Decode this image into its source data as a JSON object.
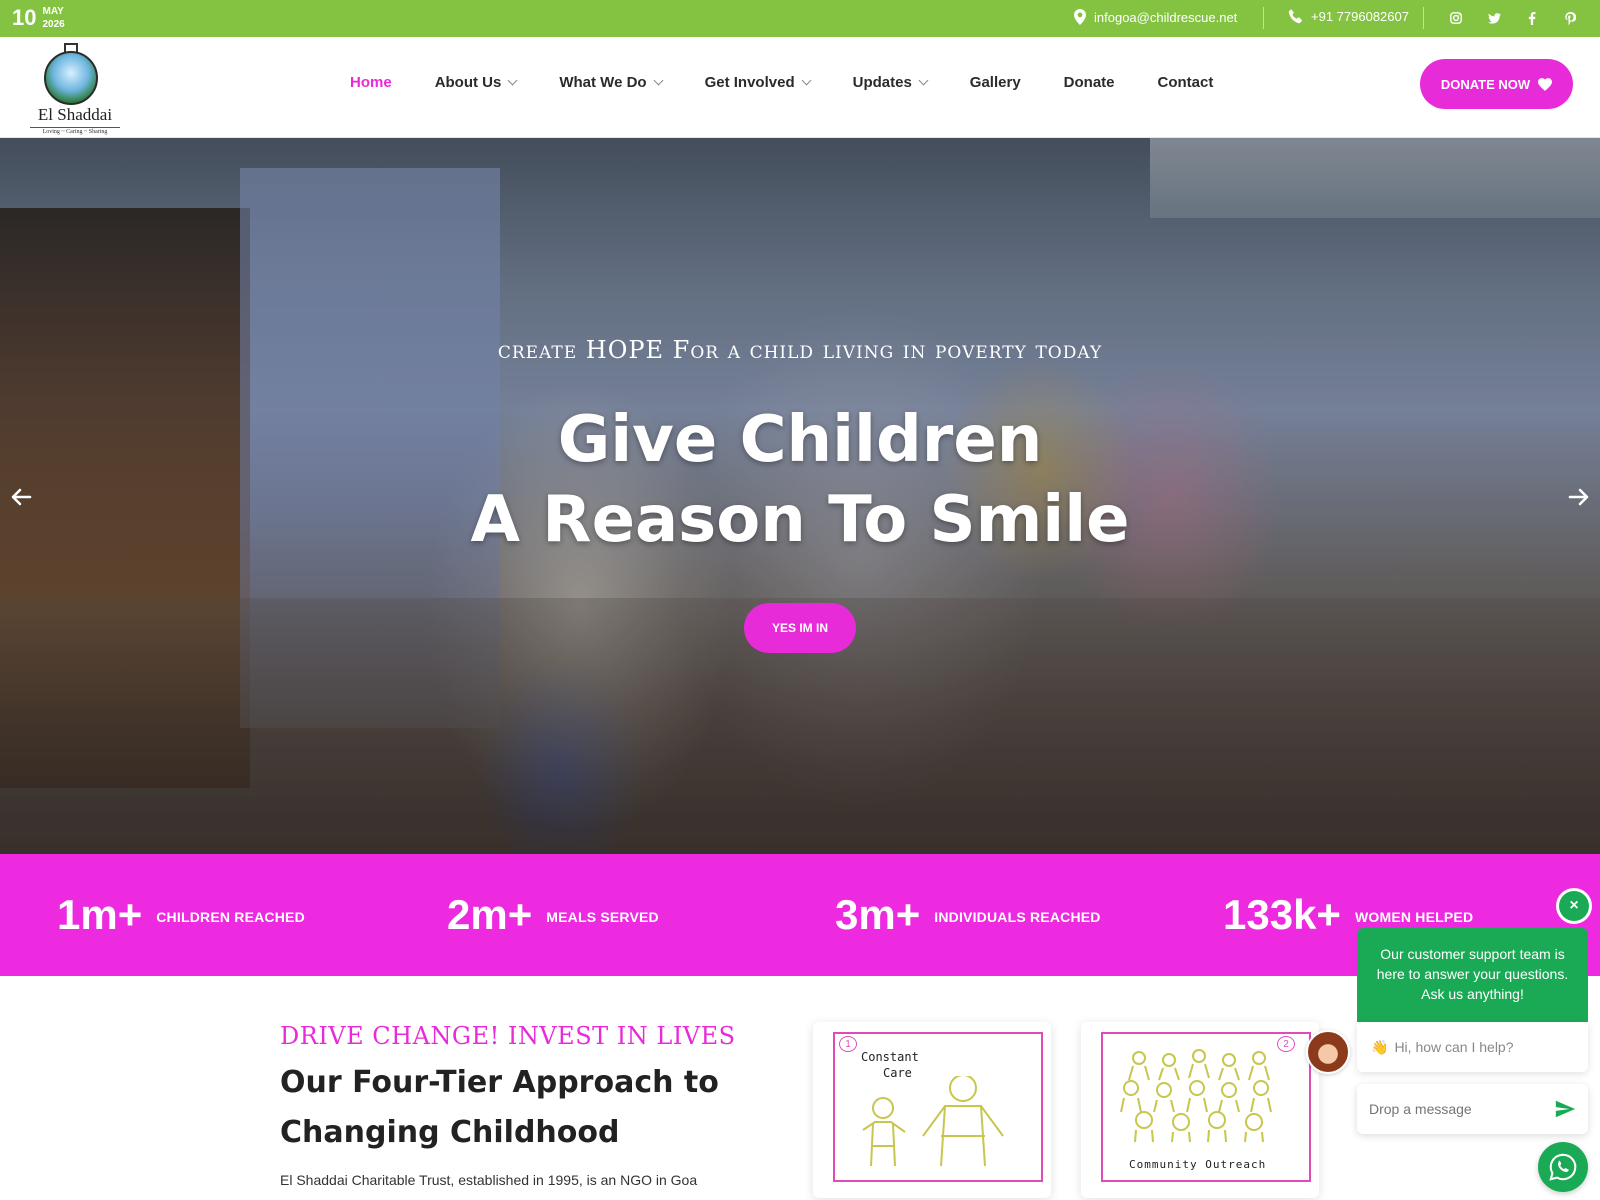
{
  "topbar": {
    "date_day": "10",
    "date_month": "MAY",
    "date_year": "2026",
    "email": "infogoa@childrescue.net",
    "phone": "+91 7796082607",
    "socials": [
      "instagram-icon",
      "twitter-icon",
      "facebook-icon",
      "pinterest-icon"
    ]
  },
  "logo": {
    "name": "El Shaddai",
    "tagline": "Loving ~ Caring ~ Sharing"
  },
  "nav": {
    "items": [
      {
        "label": "Home",
        "active": true,
        "dropdown": false
      },
      {
        "label": "About Us",
        "active": false,
        "dropdown": true
      },
      {
        "label": "What We Do",
        "active": false,
        "dropdown": true
      },
      {
        "label": "Get Involved",
        "active": false,
        "dropdown": true
      },
      {
        "label": "Updates",
        "active": false,
        "dropdown": true
      },
      {
        "label": "Gallery",
        "active": false,
        "dropdown": false
      },
      {
        "label": "Donate",
        "active": false,
        "dropdown": false
      },
      {
        "label": "Contact",
        "active": false,
        "dropdown": false
      }
    ],
    "donate_label": "DONATE NOW"
  },
  "hero": {
    "eyebrow": "create HOPE For a child living in poverty today",
    "title_line1": "Give Children",
    "title_line2": "A Reason To Smile",
    "button_label": "YES IM IN"
  },
  "stats": [
    {
      "value": "1m+",
      "label": "CHILDREN REACHED"
    },
    {
      "value": "2m+",
      "label": "MEALS SERVED"
    },
    {
      "value": "3m+",
      "label": "INDIVIDUALS REACHED"
    },
    {
      "value": "133k+",
      "label": "WOMEN HELPED"
    }
  ],
  "content": {
    "eyebrow": "DRIVE CHANGE! INVEST IN LIVES",
    "title": "Our Four-Tier Approach to Changing Childhood",
    "body": "El Shaddai Charitable Trust, established in 1995, is an NGO in Goa",
    "cards": [
      {
        "number": "1",
        "caption_line1": "Constant",
        "caption_line2": "Care"
      },
      {
        "number": "2",
        "caption_line1": "Community",
        "caption_line2": "Outreach"
      }
    ]
  },
  "chat": {
    "intro": "Our customer support team is here to answer your questions. Ask us anything!",
    "greeting": "Hi, how can I help?",
    "placeholder": "Drop a message",
    "close_label": "×"
  },
  "colors": {
    "topbar_green": "#84c341",
    "brand_pink": "#e72bd9",
    "stats_pink": "#ed2adf",
    "chat_green": "#1aaa55"
  }
}
